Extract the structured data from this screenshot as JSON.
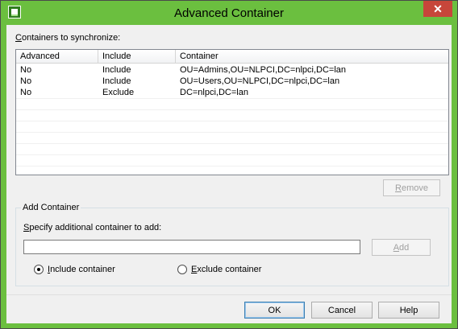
{
  "window": {
    "title": "Advanced Container",
    "close_glyph": "✕"
  },
  "sync": {
    "label_prefix": "",
    "label_hotkey": "C",
    "label_rest": "ontainers to synchronize:",
    "columns": [
      "Advanced",
      "Include",
      "Container"
    ],
    "rows": [
      [
        "No",
        "Include",
        "OU=Admins,OU=NLPCI,DC=nlpci,DC=lan"
      ],
      [
        "No",
        "Include",
        "OU=Users,OU=NLPCI,DC=nlpci,DC=lan"
      ],
      [
        "No",
        "Exclude",
        "DC=nlpci,DC=lan"
      ]
    ],
    "remove_hotkey": "R",
    "remove_rest": "emove"
  },
  "add_container": {
    "group_title": "Add Container",
    "prompt_prefix": "",
    "prompt_hotkey": "S",
    "prompt_rest": "pecify additional container to add:",
    "input_value": "",
    "add_hotkey": "A",
    "add_rest": "dd",
    "include_hotkey": "I",
    "include_rest": "nclude container",
    "exclude_hotkey": "E",
    "exclude_rest": "xclude container",
    "selected": "include"
  },
  "footer": {
    "ok": "OK",
    "cancel": "Cancel",
    "help": "Help"
  },
  "colors": {
    "titlebar": "#6bbf3f",
    "close": "#c7463a",
    "dialog_bg": "#f0f0f0"
  }
}
